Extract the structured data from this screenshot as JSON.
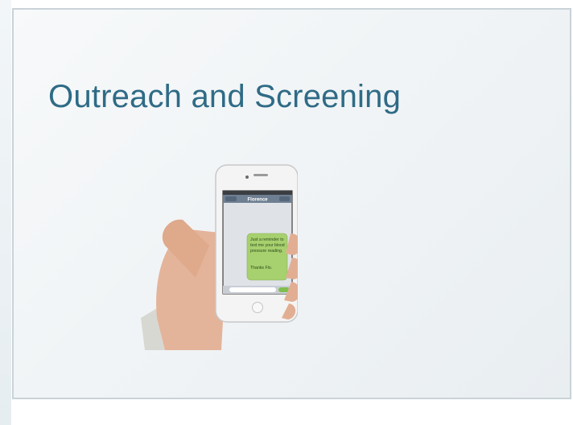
{
  "slide": {
    "title": "Outreach and Screening"
  },
  "phone": {
    "contact_name": "Florence",
    "message_lines": [
      "Just a reminder to",
      "text me your blood",
      "pressure reading.",
      "",
      "Thanks Flo."
    ],
    "colors": {
      "bubble": "#a7d06e",
      "title": "#2f6b86"
    }
  }
}
